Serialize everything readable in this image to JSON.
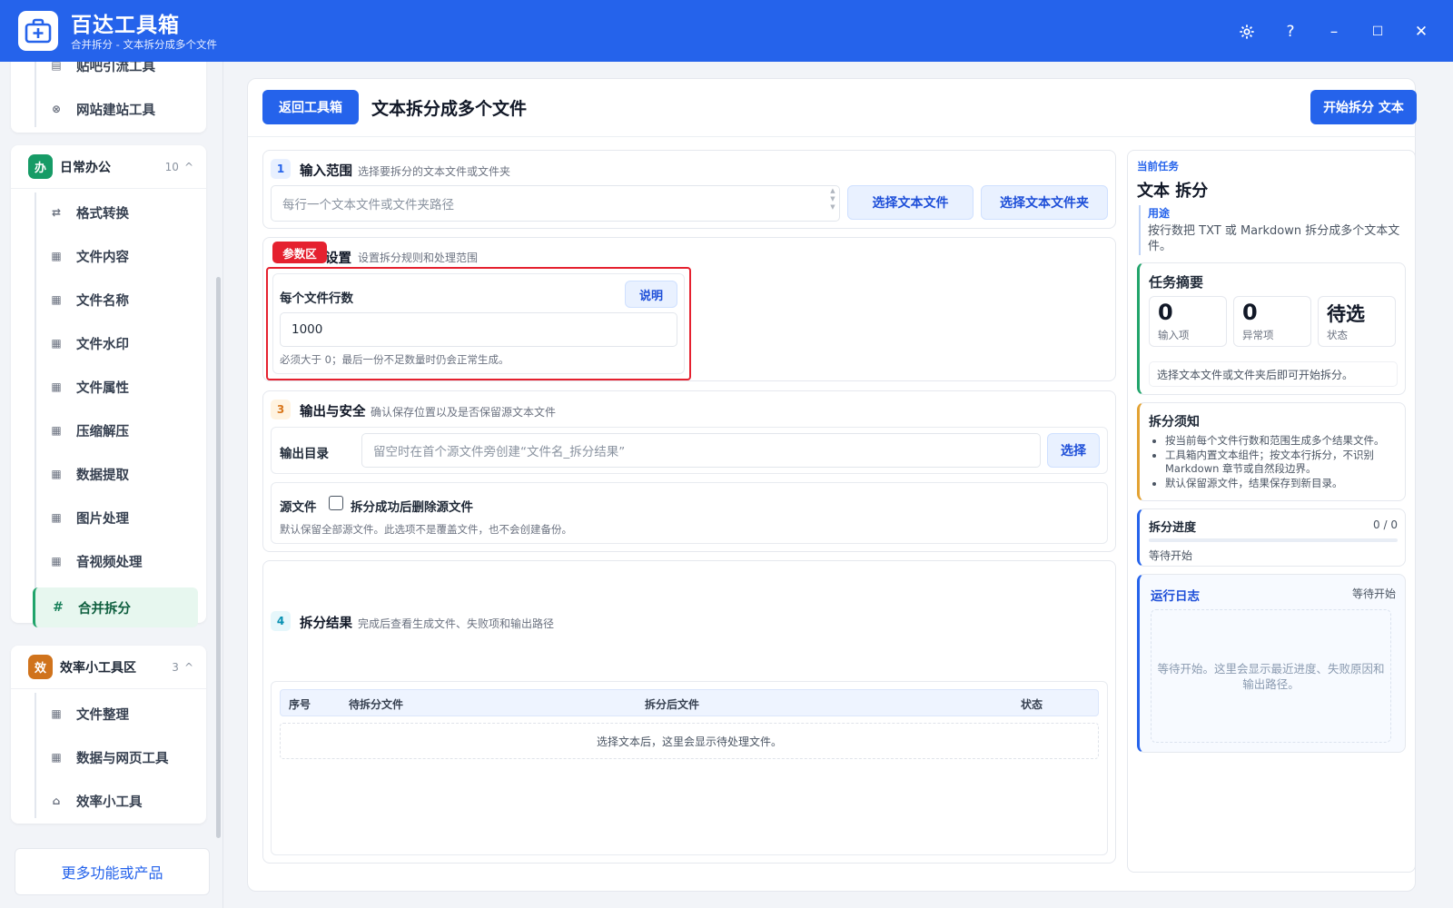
{
  "window": {
    "title": "百达工具箱",
    "subtitle": "合并拆分 - 文本拆分成多个文件",
    "settings_icon": "gear-icon",
    "help_label": "?",
    "minimize_label": "–",
    "maximize_label": "☐",
    "close_label": "✕"
  },
  "sidebar": {
    "top_items": [
      {
        "label": "贴吧引流工具",
        "icon": "document-icon"
      },
      {
        "label": "网站建站工具",
        "icon": "globe-icon"
      }
    ],
    "group_office": {
      "badge": "办",
      "title": "日常办公",
      "count": "10",
      "chevron": "^",
      "items": [
        {
          "label": "格式转换",
          "icon": "swap-icon"
        },
        {
          "label": "文件内容",
          "icon": "grid-icon"
        },
        {
          "label": "文件名称",
          "icon": "grid-icon"
        },
        {
          "label": "文件水印",
          "icon": "grid-icon"
        },
        {
          "label": "文件属性",
          "icon": "grid-icon"
        },
        {
          "label": "压缩解压",
          "icon": "grid-icon"
        },
        {
          "label": "数据提取",
          "icon": "grid-icon"
        },
        {
          "label": "图片处理",
          "icon": "grid-icon"
        },
        {
          "label": "音视频处理",
          "icon": "grid-icon"
        },
        {
          "label": "合并拆分",
          "icon": "hash-icon",
          "active": true
        }
      ]
    },
    "group_efficiency": {
      "badge": "效",
      "title": "效率小工具区",
      "count": "3",
      "chevron": "^",
      "items": [
        {
          "label": "文件整理",
          "icon": "grid-icon"
        },
        {
          "label": "数据与网页工具",
          "icon": "grid-icon"
        },
        {
          "label": "效率小工具",
          "icon": "toolbox-icon"
        }
      ]
    },
    "more_button": "更多功能或产品"
  },
  "header": {
    "back_button": "返回工具箱",
    "page_title": "文本拆分成多个文件",
    "start_button": "开始拆分 文本"
  },
  "step1": {
    "num": "1",
    "title": "输入范围",
    "desc": "选择要拆分的文本文件或文件夹",
    "textarea_placeholder": "每行一个文本文件或文件夹路径",
    "select_file_button": "选择文本文件",
    "select_folder_button": "选择文本文件夹"
  },
  "step2": {
    "tag": "参数区",
    "title": "设置",
    "desc": "设置拆分规则和处理范围",
    "field_label": "每个文件行数",
    "help_button": "说明",
    "value": "1000",
    "hint": "必须大于 0；最后一份不足数量时仍会正常生成。"
  },
  "step3": {
    "num": "3",
    "title": "输出与安全",
    "desc": "确认保存位置以及是否保留源文本文件",
    "output_label": "输出目录",
    "output_placeholder": "留空时在首个源文件旁创建“文件名_拆分结果”",
    "choose_button": "选择",
    "source_label": "源文件",
    "delete_checkbox_label": "拆分成功后删除源文件",
    "delete_checked": false,
    "source_hint": "默认保留全部源文件。此选项不是覆盖文件，也不会创建备份。"
  },
  "step4": {
    "num": "4",
    "title": "拆分结果",
    "desc": "完成后查看生成文件、失败项和输出路径",
    "columns": [
      "序号",
      "待拆分文件",
      "拆分后文件",
      "状态"
    ],
    "empty_text": "选择文本后，这里会显示待处理文件。"
  },
  "task": {
    "label": "当前任务",
    "name": "文本 拆分",
    "purpose_label": "用途",
    "purpose_text": "按行数把 TXT 或 Markdown 拆分成多个文本文件。"
  },
  "summary": {
    "title": "任务摘要",
    "stats": [
      {
        "value": "0",
        "label": "输入项"
      },
      {
        "value": "0",
        "label": "异常项"
      },
      {
        "value": "待选",
        "label": "状态"
      }
    ],
    "note": "选择文本文件或文件夹后即可开始拆分。"
  },
  "notice": {
    "title": "拆分须知",
    "items": [
      "按当前每个文件行数和范围生成多个结果文件。",
      "工具箱内置文本组件；按文本行拆分，不识别 Markdown 章节或自然段边界。",
      "默认保留源文件，结果保存到新目录。"
    ]
  },
  "progress": {
    "title": "拆分进度",
    "count": "0 / 0",
    "fraction": 0,
    "status": "等待开始"
  },
  "log": {
    "title": "运行日志",
    "status": "等待开始",
    "placeholder": "等待开始。这里会显示最近进度、失败原因和输出路径。"
  },
  "colors": {
    "primary": "#2563eb",
    "active_green": "#21a46b",
    "office_badge": "#169b66",
    "efficiency_badge": "#d0731c",
    "highlight_red": "#e5212f"
  }
}
